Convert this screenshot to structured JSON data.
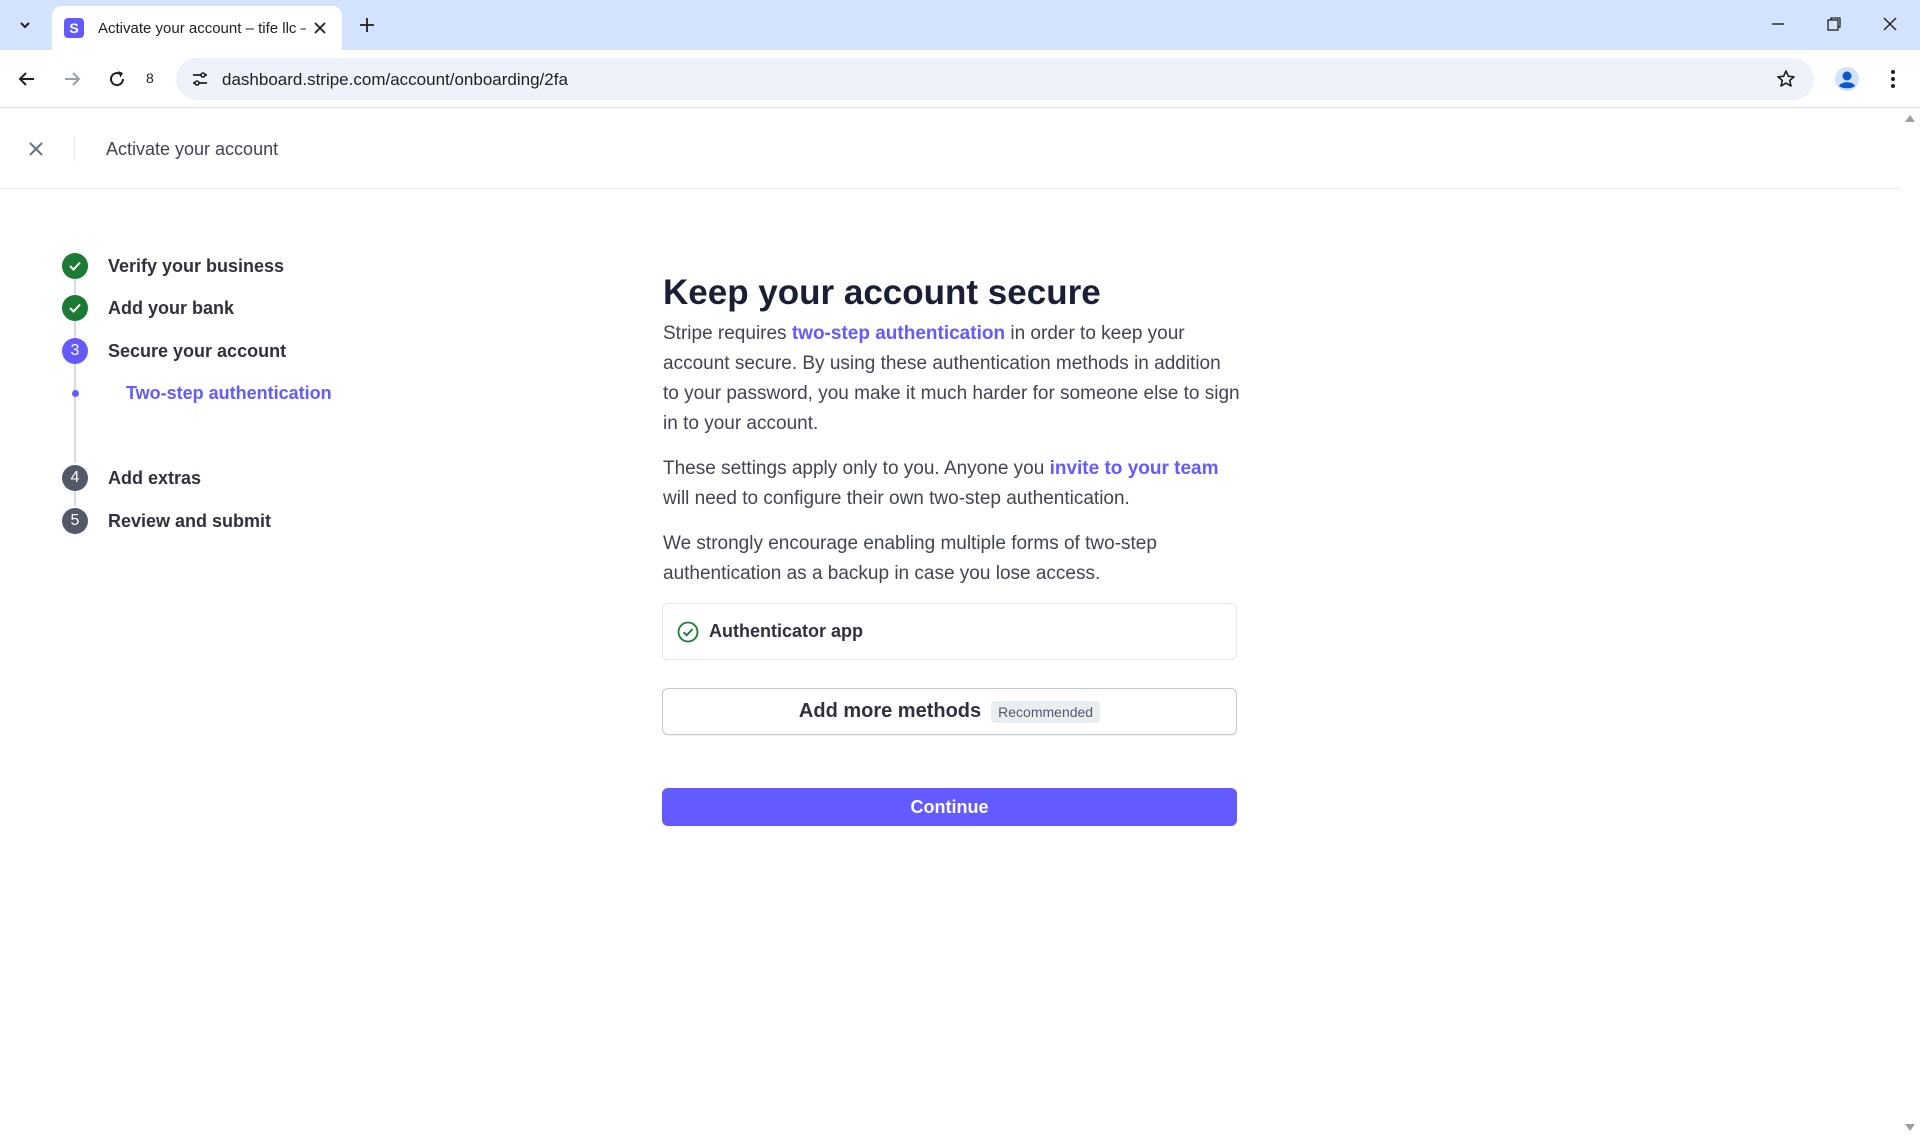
{
  "browser": {
    "tab_title": "Activate your account – tife llc –",
    "favicon_letter": "S",
    "tab_count": "8",
    "url": "dashboard.stripe.com/account/onboarding/2fa"
  },
  "header": {
    "title": "Activate your account"
  },
  "steps": [
    {
      "label": "Verify your business",
      "state": "done",
      "number": ""
    },
    {
      "label": "Add your bank",
      "state": "done",
      "number": ""
    },
    {
      "label": "Secure your account",
      "state": "current",
      "number": "3"
    },
    {
      "label": "Add extras",
      "state": "todo",
      "number": "4"
    },
    {
      "label": "Review and submit",
      "state": "todo",
      "number": "5"
    }
  ],
  "substep": {
    "label": "Two-step authentication"
  },
  "main": {
    "heading": "Keep your account secure",
    "p1_before": "Stripe requires ",
    "p1_link": "two-step authentication",
    "p1_after": " in order to keep your account secure. By using these authentication methods in addition to your password, you make it much harder for someone else to sign in to your account.",
    "p2_before": "These settings apply only to you. Anyone you ",
    "p2_link": "invite to your team",
    "p2_after": " will need to configure their own two-step authentication.",
    "p3": "We strongly encourage enabling multiple forms of two-step authentication as a backup in case you lose access.",
    "method_label": "Authenticator app",
    "add_methods_label": "Add more methods",
    "recommended_badge": "Recommended",
    "continue_label": "Continue"
  },
  "colors": {
    "accent": "#635bff",
    "success": "#1b7a34",
    "chrome": "#d3e3fd"
  }
}
